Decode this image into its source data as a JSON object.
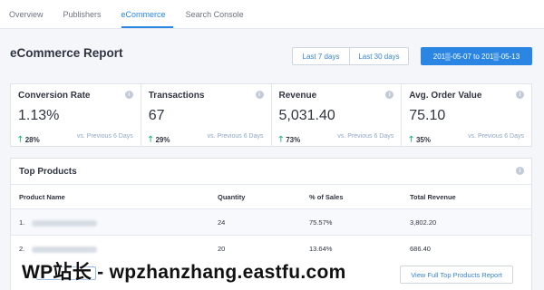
{
  "tabs": [
    {
      "label": "Overview"
    },
    {
      "label": "Publishers"
    },
    {
      "label": "eCommerce"
    },
    {
      "label": "Search Console"
    }
  ],
  "active_tab": "eCommerce",
  "page_title": "eCommerce Report",
  "range_buttons": {
    "last7": "Last 7 days",
    "last30": "Last 30 days"
  },
  "date_range": "201▒-05-07 to 201▒-05-13",
  "stats": [
    {
      "label": "Conversion Rate",
      "value": "1.13%",
      "change": "28%",
      "compare": "vs. Previous 6 Days"
    },
    {
      "label": "Transactions",
      "value": "67",
      "change": "29%",
      "compare": "vs. Previous 6 Days"
    },
    {
      "label": "Revenue",
      "value": "5,031.40",
      "change": "73%",
      "compare": "vs. Previous 6 Days"
    },
    {
      "label": "Avg. Order Value",
      "value": "75.10",
      "change": "35%",
      "compare": "vs. Previous 6 Days"
    }
  ],
  "info_glyph": "i",
  "top_products": {
    "title": "Top Products",
    "columns": [
      "Product Name",
      "Quantity",
      "% of Sales",
      "Total Revenue"
    ],
    "rows": [
      {
        "index": "1.",
        "quantity": "24",
        "percent": "75.57%",
        "revenue": "3,802.20"
      },
      {
        "index": "2.",
        "quantity": "20",
        "percent": "13.64%",
        "revenue": "686.40"
      }
    ],
    "view_full": "View Full Top Products Report"
  },
  "watermark": "WP站长 - wpzhanzhang.eastfu.com",
  "colors": {
    "accent": "#2a86e2",
    "positive": "#22b07a"
  }
}
